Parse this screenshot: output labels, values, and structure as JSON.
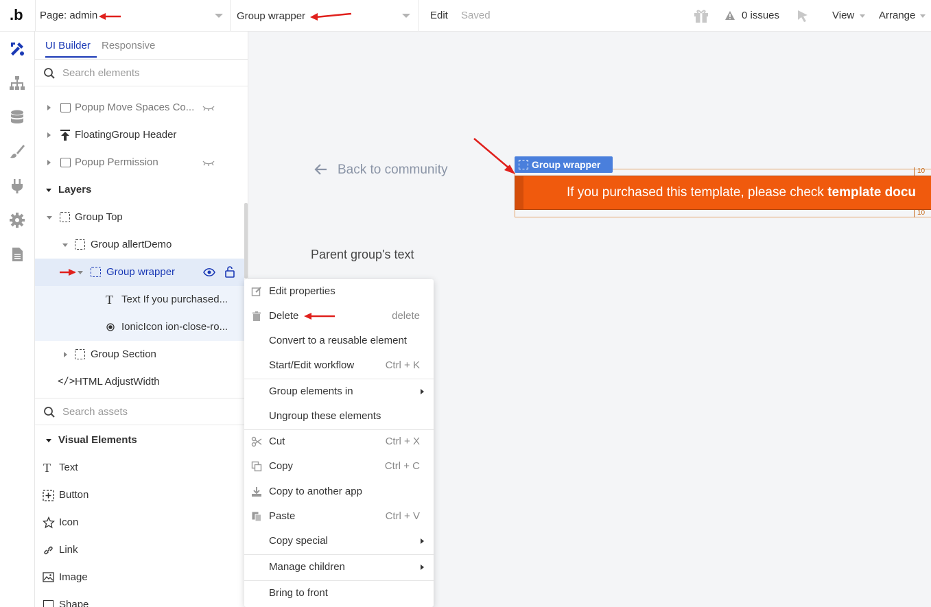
{
  "topbar": {
    "logo": ".b",
    "page_label": "Page: admin",
    "element_select": "Group wrapper",
    "edit": "Edit",
    "saved": "Saved",
    "issues": "0 issues",
    "view": "View",
    "arrange": "Arrange"
  },
  "rail": {
    "icons": [
      "design-icon",
      "workflow-icon",
      "data-icon",
      "styles-icon",
      "plugins-icon",
      "settings-icon",
      "logs-icon"
    ]
  },
  "panel": {
    "tabs": {
      "ui_builder": "UI Builder",
      "responsive": "Responsive"
    },
    "search_elements_placeholder": "Search elements",
    "tree": {
      "popup_move": "Popup Move Spaces Co...",
      "floating_header": "FloatingGroup Header",
      "popup_permission": "Popup Permission",
      "layers": "Layers",
      "group_top": "Group Top",
      "group_allert": "Group allertDemo",
      "group_wrapper": "Group wrapper",
      "text_item": "Text If you purchased...",
      "icon_item": "IonicIcon ion-close-ro...",
      "group_section": "Group Section",
      "html_adjust": "HTML AdjustWidth"
    },
    "search_assets_placeholder": "Search assets",
    "visual_elements": "Visual Elements",
    "assets": {
      "text": "Text",
      "button": "Button",
      "icon": "Icon",
      "link": "Link",
      "image": "Image",
      "shape": "Shape"
    }
  },
  "canvas": {
    "back_link": "Back to community",
    "wrapper_tag": "Group wrapper",
    "banner_text": "If you purchased this template, please check ",
    "banner_bold": "template docu",
    "parent_text": "Parent group's text",
    "margin_top": "10",
    "margin_bottom": "10"
  },
  "context_menu": {
    "edit_properties": "Edit properties",
    "delete": "Delete",
    "delete_shortcut": "delete",
    "convert": "Convert to a reusable element",
    "workflow": "Start/Edit workflow",
    "workflow_shortcut": "Ctrl + K",
    "group_in": "Group elements in",
    "ungroup": "Ungroup these elements",
    "cut": "Cut",
    "cut_shortcut": "Ctrl + X",
    "copy": "Copy",
    "copy_shortcut": "Ctrl + C",
    "copy_app": "Copy to another app",
    "paste": "Paste",
    "paste_shortcut": "Ctrl + V",
    "copy_special": "Copy special",
    "manage_children": "Manage children",
    "bring_front": "Bring to front"
  },
  "colors": {
    "accent_blue": "#1a39b5",
    "selection_blue": "#4a7fdc",
    "banner_orange": "#f05a0d",
    "arrow_red": "#e0201c"
  }
}
